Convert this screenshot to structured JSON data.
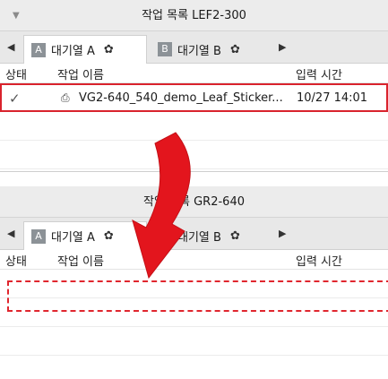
{
  "panel1": {
    "title": "작업 목록 LEF2-300",
    "tabs": [
      {
        "badge": "A",
        "label": "대기열 A"
      },
      {
        "badge": "B",
        "label": "대기열 B"
      }
    ],
    "columns": {
      "status": "상태",
      "name": "작업 이름",
      "time": "입력 시간"
    },
    "rows": [
      {
        "job_name": "VG2-640_540_demo_Leaf_Sticker...",
        "input_time": "10/27 14:01"
      }
    ]
  },
  "panel2": {
    "title": "작업 목록 GR2-640",
    "tabs": [
      {
        "badge": "A",
        "label": "대기열 A"
      },
      {
        "badge": "B",
        "label": "대기열 B"
      }
    ],
    "columns": {
      "status": "상태",
      "name": "작업 이름",
      "time": "입력 시간"
    }
  },
  "icons": {
    "collapse": "triangle-down-icon",
    "tab_left": "triangle-left-icon",
    "tab_right": "triangle-right-icon",
    "gear": "gear-icon",
    "job_status": "check-icon",
    "job_file": "printer-file-icon",
    "drag_arrow": "curved-arrow-down-icon"
  },
  "colors": {
    "highlight": "#d9232d",
    "badge": "#8c9297",
    "title_bar": "#ececec"
  }
}
